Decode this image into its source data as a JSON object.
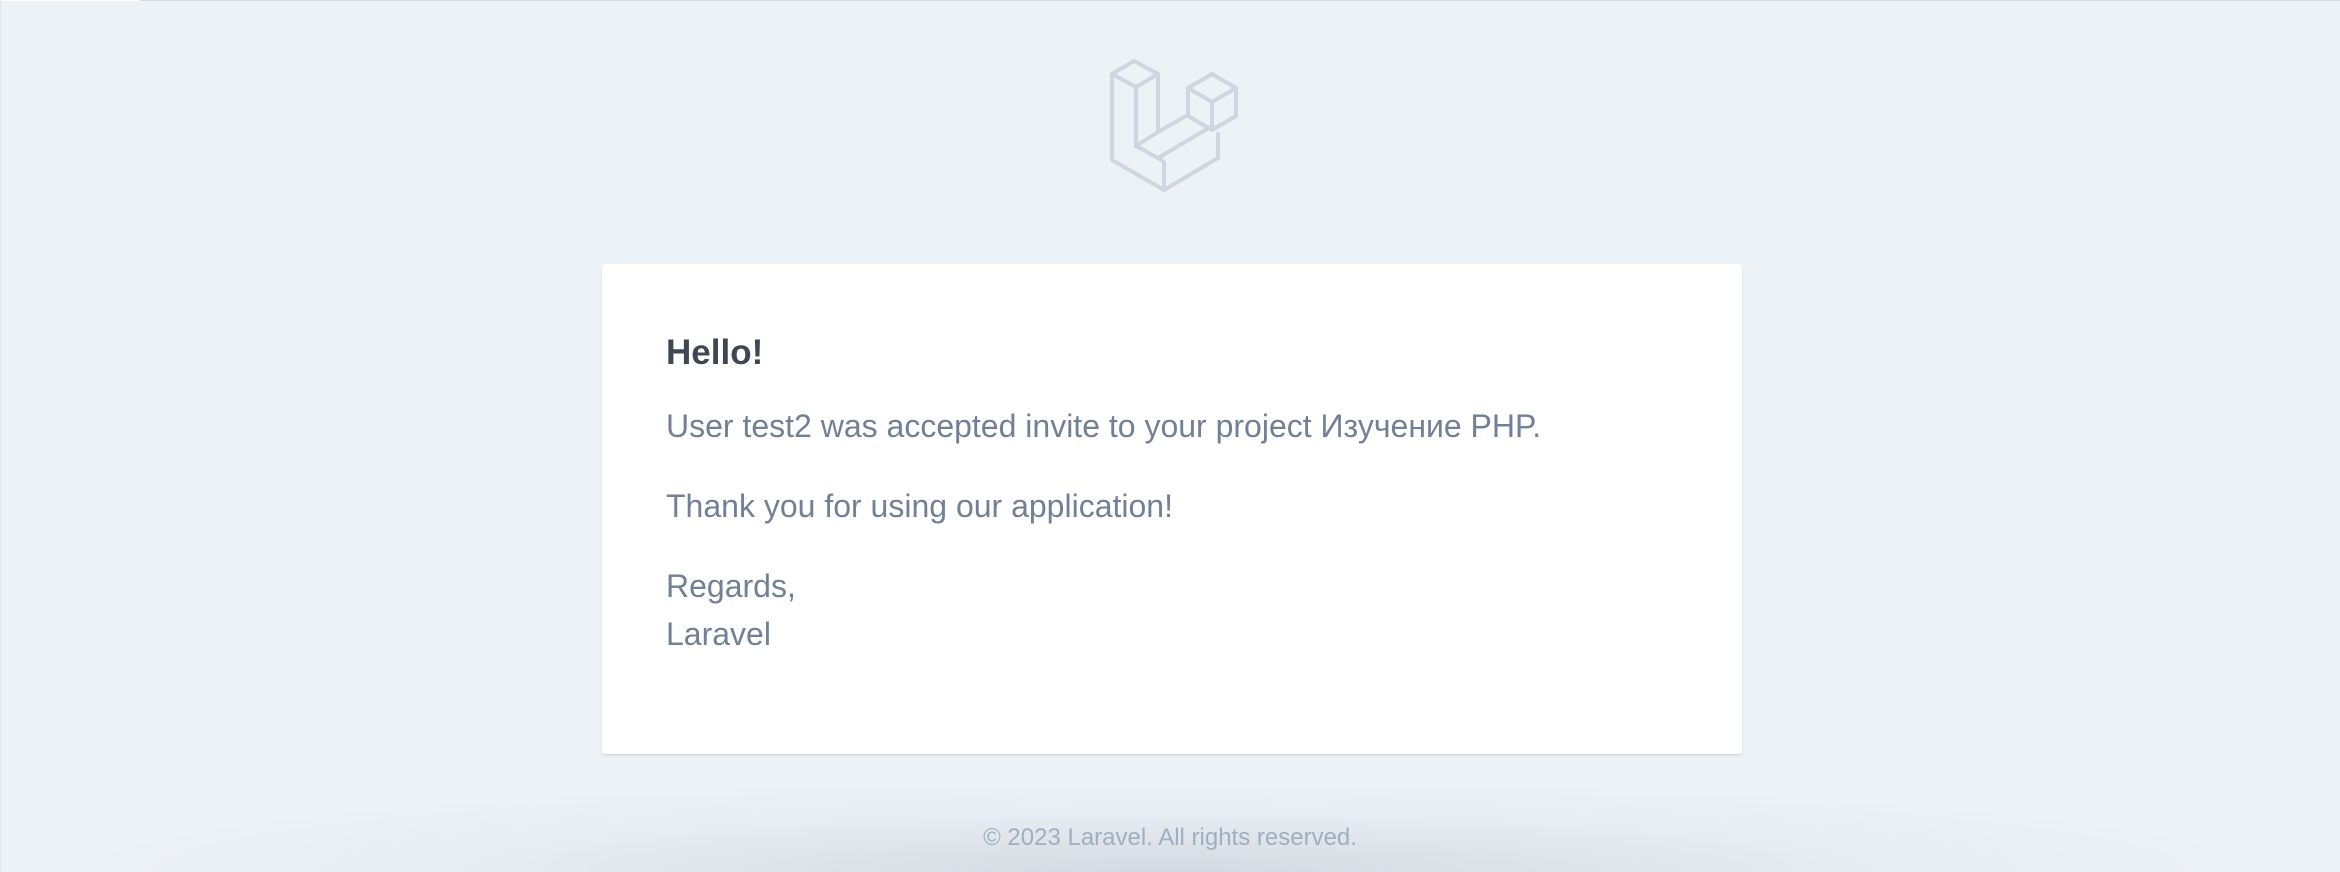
{
  "email": {
    "greeting": "Hello!",
    "lines": [
      "User test2 was accepted invite to your project Изучение PHP.",
      "Thank you for using our application!"
    ],
    "salutation": "Regards,",
    "signature": "Laravel"
  },
  "header": {
    "logo_icon": "laravel-logo-icon",
    "logo_color": "#cfd6e0"
  },
  "footer": {
    "copyright": "© 2023 Laravel. All rights reserved."
  },
  "colors": {
    "background": "#edf2f7",
    "card": "#ffffff",
    "heading": "#3d4852",
    "body_text": "#718096",
    "footer_text": "#a0aec0"
  }
}
